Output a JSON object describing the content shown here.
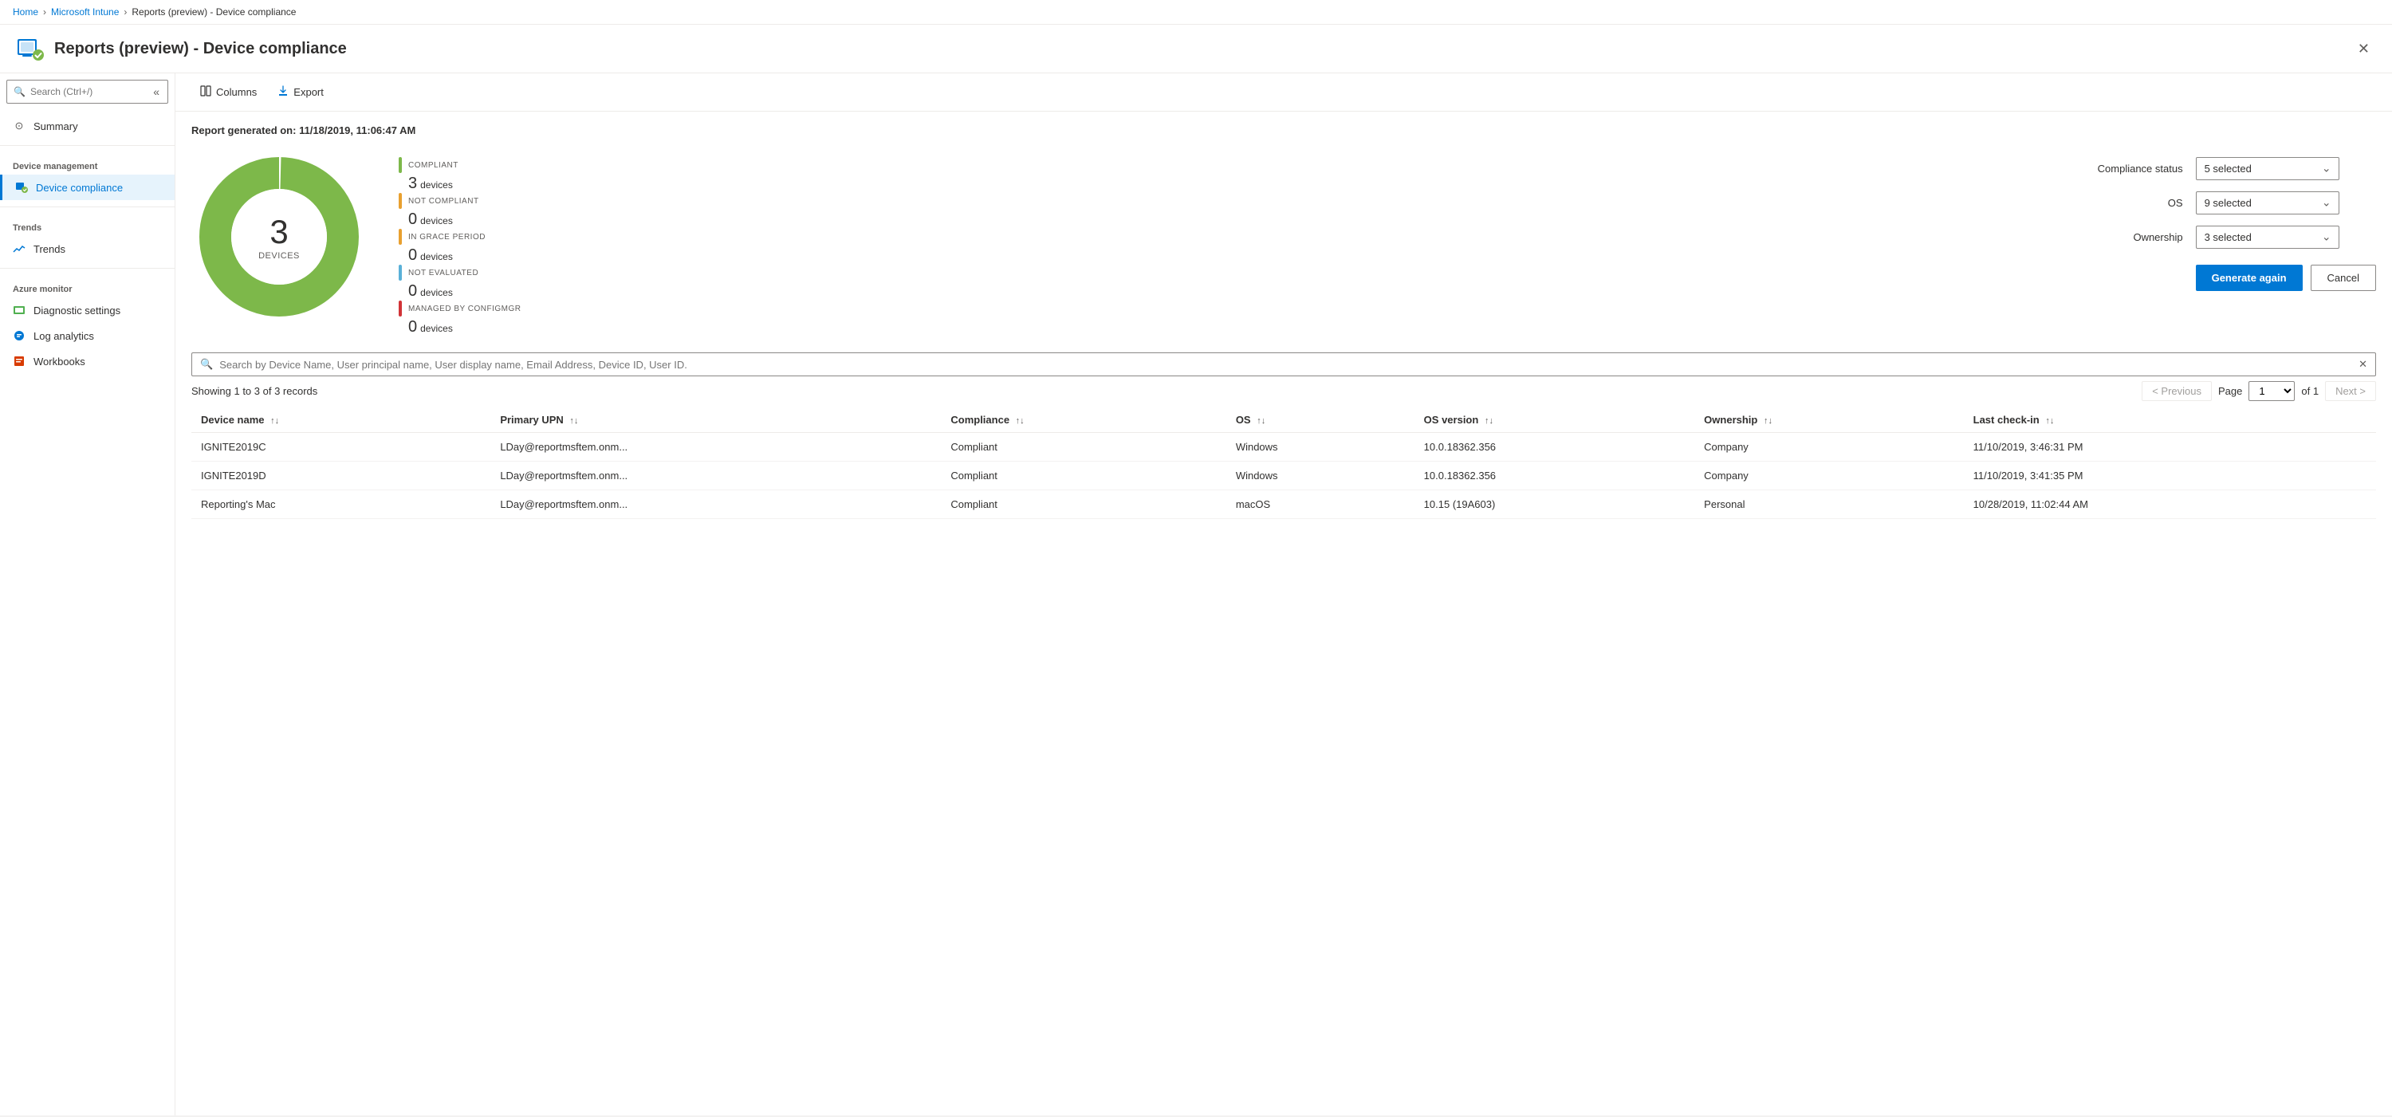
{
  "breadcrumb": {
    "items": [
      "Home",
      "Microsoft Intune",
      "Reports (preview) - Device compliance"
    ],
    "links": [
      "Home",
      "Microsoft Intune"
    ]
  },
  "page": {
    "title": "Reports (preview) - Device compliance",
    "generated_label": "Report generated on: 11/18/2019, 11:06:47 AM"
  },
  "sidebar": {
    "search_placeholder": "Search (Ctrl+/)",
    "items": [
      {
        "id": "summary",
        "label": "Summary",
        "section": null,
        "active": false
      },
      {
        "id": "device-management-header",
        "label": "Device management",
        "section": true
      },
      {
        "id": "device-compliance",
        "label": "Device compliance",
        "section": null,
        "active": true
      },
      {
        "id": "trends-header",
        "label": "Trends",
        "section": true
      },
      {
        "id": "trends",
        "label": "Trends",
        "section": null,
        "active": false
      },
      {
        "id": "azure-monitor-header",
        "label": "Azure monitor",
        "section": true
      },
      {
        "id": "diagnostic-settings",
        "label": "Diagnostic settings",
        "section": null,
        "active": false
      },
      {
        "id": "log-analytics",
        "label": "Log analytics",
        "section": null,
        "active": false
      },
      {
        "id": "workbooks",
        "label": "Workbooks",
        "section": null,
        "active": false
      }
    ]
  },
  "toolbar": {
    "columns_label": "Columns",
    "export_label": "Export"
  },
  "chart": {
    "total": "3",
    "total_label": "DEVICES",
    "legend": [
      {
        "id": "compliant",
        "status": "COMPLIANT",
        "count": "3",
        "devices_label": "devices",
        "color": "#7db84a"
      },
      {
        "id": "not-compliant",
        "status": "NOT COMPLIANT",
        "count": "0",
        "devices_label": "devices",
        "color": "#e8a030"
      },
      {
        "id": "in-grace-period",
        "status": "IN GRACE PERIOD",
        "count": "0",
        "devices_label": "devices",
        "color": "#e8a030"
      },
      {
        "id": "not-evaluated",
        "status": "NOT EVALUATED",
        "count": "0",
        "devices_label": "devices",
        "color": "#5ab0d8"
      },
      {
        "id": "managed-by-configmgr",
        "status": "MANAGED BY CONFIGMGR",
        "count": "0",
        "devices_label": "devices",
        "color": "#d13438"
      }
    ]
  },
  "filters": {
    "compliance_status_label": "Compliance status",
    "compliance_status_value": "5 selected",
    "os_label": "OS",
    "os_value": "9 selected",
    "ownership_label": "Ownership",
    "ownership_value": "3 selected",
    "generate_again_label": "Generate again",
    "cancel_label": "Cancel"
  },
  "table": {
    "search_placeholder": "Search by Device Name, User principal name, User display name, Email Address, Device ID, User ID.",
    "showing_label": "Showing 1 to 3 of 3 records",
    "pagination": {
      "previous_label": "< Previous",
      "page_label": "Page",
      "page_value": "1",
      "of_label": "of 1",
      "next_label": "Next >"
    },
    "columns": [
      {
        "id": "device-name",
        "label": "Device name"
      },
      {
        "id": "primary-upn",
        "label": "Primary UPN"
      },
      {
        "id": "compliance",
        "label": "Compliance"
      },
      {
        "id": "os",
        "label": "OS"
      },
      {
        "id": "os-version",
        "label": "OS version"
      },
      {
        "id": "ownership",
        "label": "Ownership"
      },
      {
        "id": "last-checkin",
        "label": "Last check-in"
      }
    ],
    "rows": [
      {
        "device_name": "IGNITE2019C",
        "primary_upn": "LDay@reportmsftem.onm...",
        "compliance": "Compliant",
        "os": "Windows",
        "os_version": "10.0.18362.356",
        "ownership": "Company",
        "last_checkin": "11/10/2019, 3:46:31 PM"
      },
      {
        "device_name": "IGNITE2019D",
        "primary_upn": "LDay@reportmsftem.onm...",
        "compliance": "Compliant",
        "os": "Windows",
        "os_version": "10.0.18362.356",
        "ownership": "Company",
        "last_checkin": "11/10/2019, 3:41:35 PM"
      },
      {
        "device_name": "Reporting's Mac",
        "primary_upn": "LDay@reportmsftem.onm...",
        "compliance": "Compliant",
        "os": "macOS",
        "os_version": "10.15 (19A603)",
        "ownership": "Personal",
        "last_checkin": "10/28/2019, 11:02:44 AM"
      }
    ]
  }
}
